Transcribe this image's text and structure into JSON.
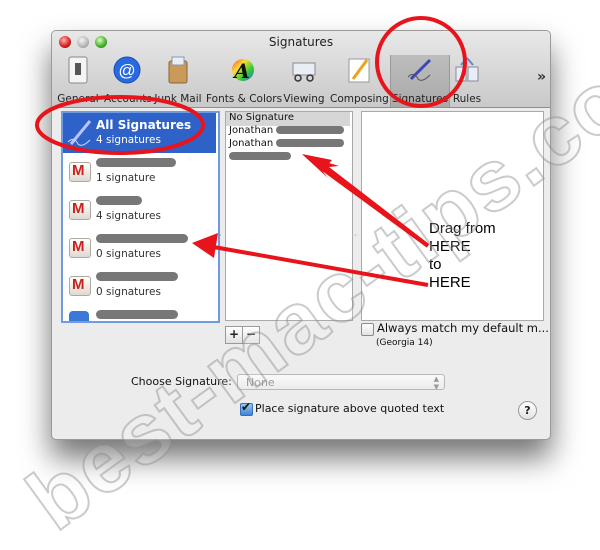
{
  "window": {
    "title": "Signatures"
  },
  "toolbar": {
    "items": [
      {
        "label": "General",
        "icon": "general-switch-icon"
      },
      {
        "label": "Accounts",
        "icon": "at-sign-icon"
      },
      {
        "label": "Junk Mail",
        "icon": "junk-mail-icon"
      },
      {
        "label": "Fonts & Colors",
        "icon": "fonts-colors-icon"
      },
      {
        "label": "Viewing",
        "icon": "viewing-glasses-icon"
      },
      {
        "label": "Composing",
        "icon": "composing-pencil-icon"
      },
      {
        "label": "Signatures",
        "icon": "signature-pen-icon",
        "selected": true
      },
      {
        "label": "Rules",
        "icon": "rules-icon"
      }
    ],
    "overflow": "»"
  },
  "accounts": {
    "all": {
      "title": "All Signatures",
      "count": "4 signatures"
    },
    "items": [
      {
        "name": "[redacted]",
        "count": "1 signature"
      },
      {
        "name": "[redacted]",
        "count": "4 signatures"
      },
      {
        "name": "[redacted]",
        "count": "0 signatures"
      },
      {
        "name": "[redacted]",
        "count": "0 signatures"
      },
      {
        "name": "[redacted]",
        "count": ""
      }
    ]
  },
  "signatures": {
    "items": [
      {
        "label": "No Signature",
        "selected": true
      },
      {
        "label": "Jonathan",
        "redacted_suffix": true
      },
      {
        "label": "Jonathan",
        "redacted_suffix": true
      },
      {
        "label": "",
        "redacted_suffix": true
      }
    ],
    "add_label": "+",
    "remove_label": "−"
  },
  "preview": {
    "always_match_label": "Always match my default m...",
    "always_match_checked": false,
    "font_note": "(Georgia 14)"
  },
  "footer": {
    "choose_label": "Choose Signature:",
    "choose_value": "None",
    "place_above_label": "Place signature above quoted text",
    "place_above_checked": true,
    "help_label": "?"
  },
  "annotation": {
    "lines": [
      "Drag from",
      "HERE",
      "to",
      "HERE"
    ],
    "color": "#e8141b"
  },
  "watermark": "best-mac-tips.com"
}
